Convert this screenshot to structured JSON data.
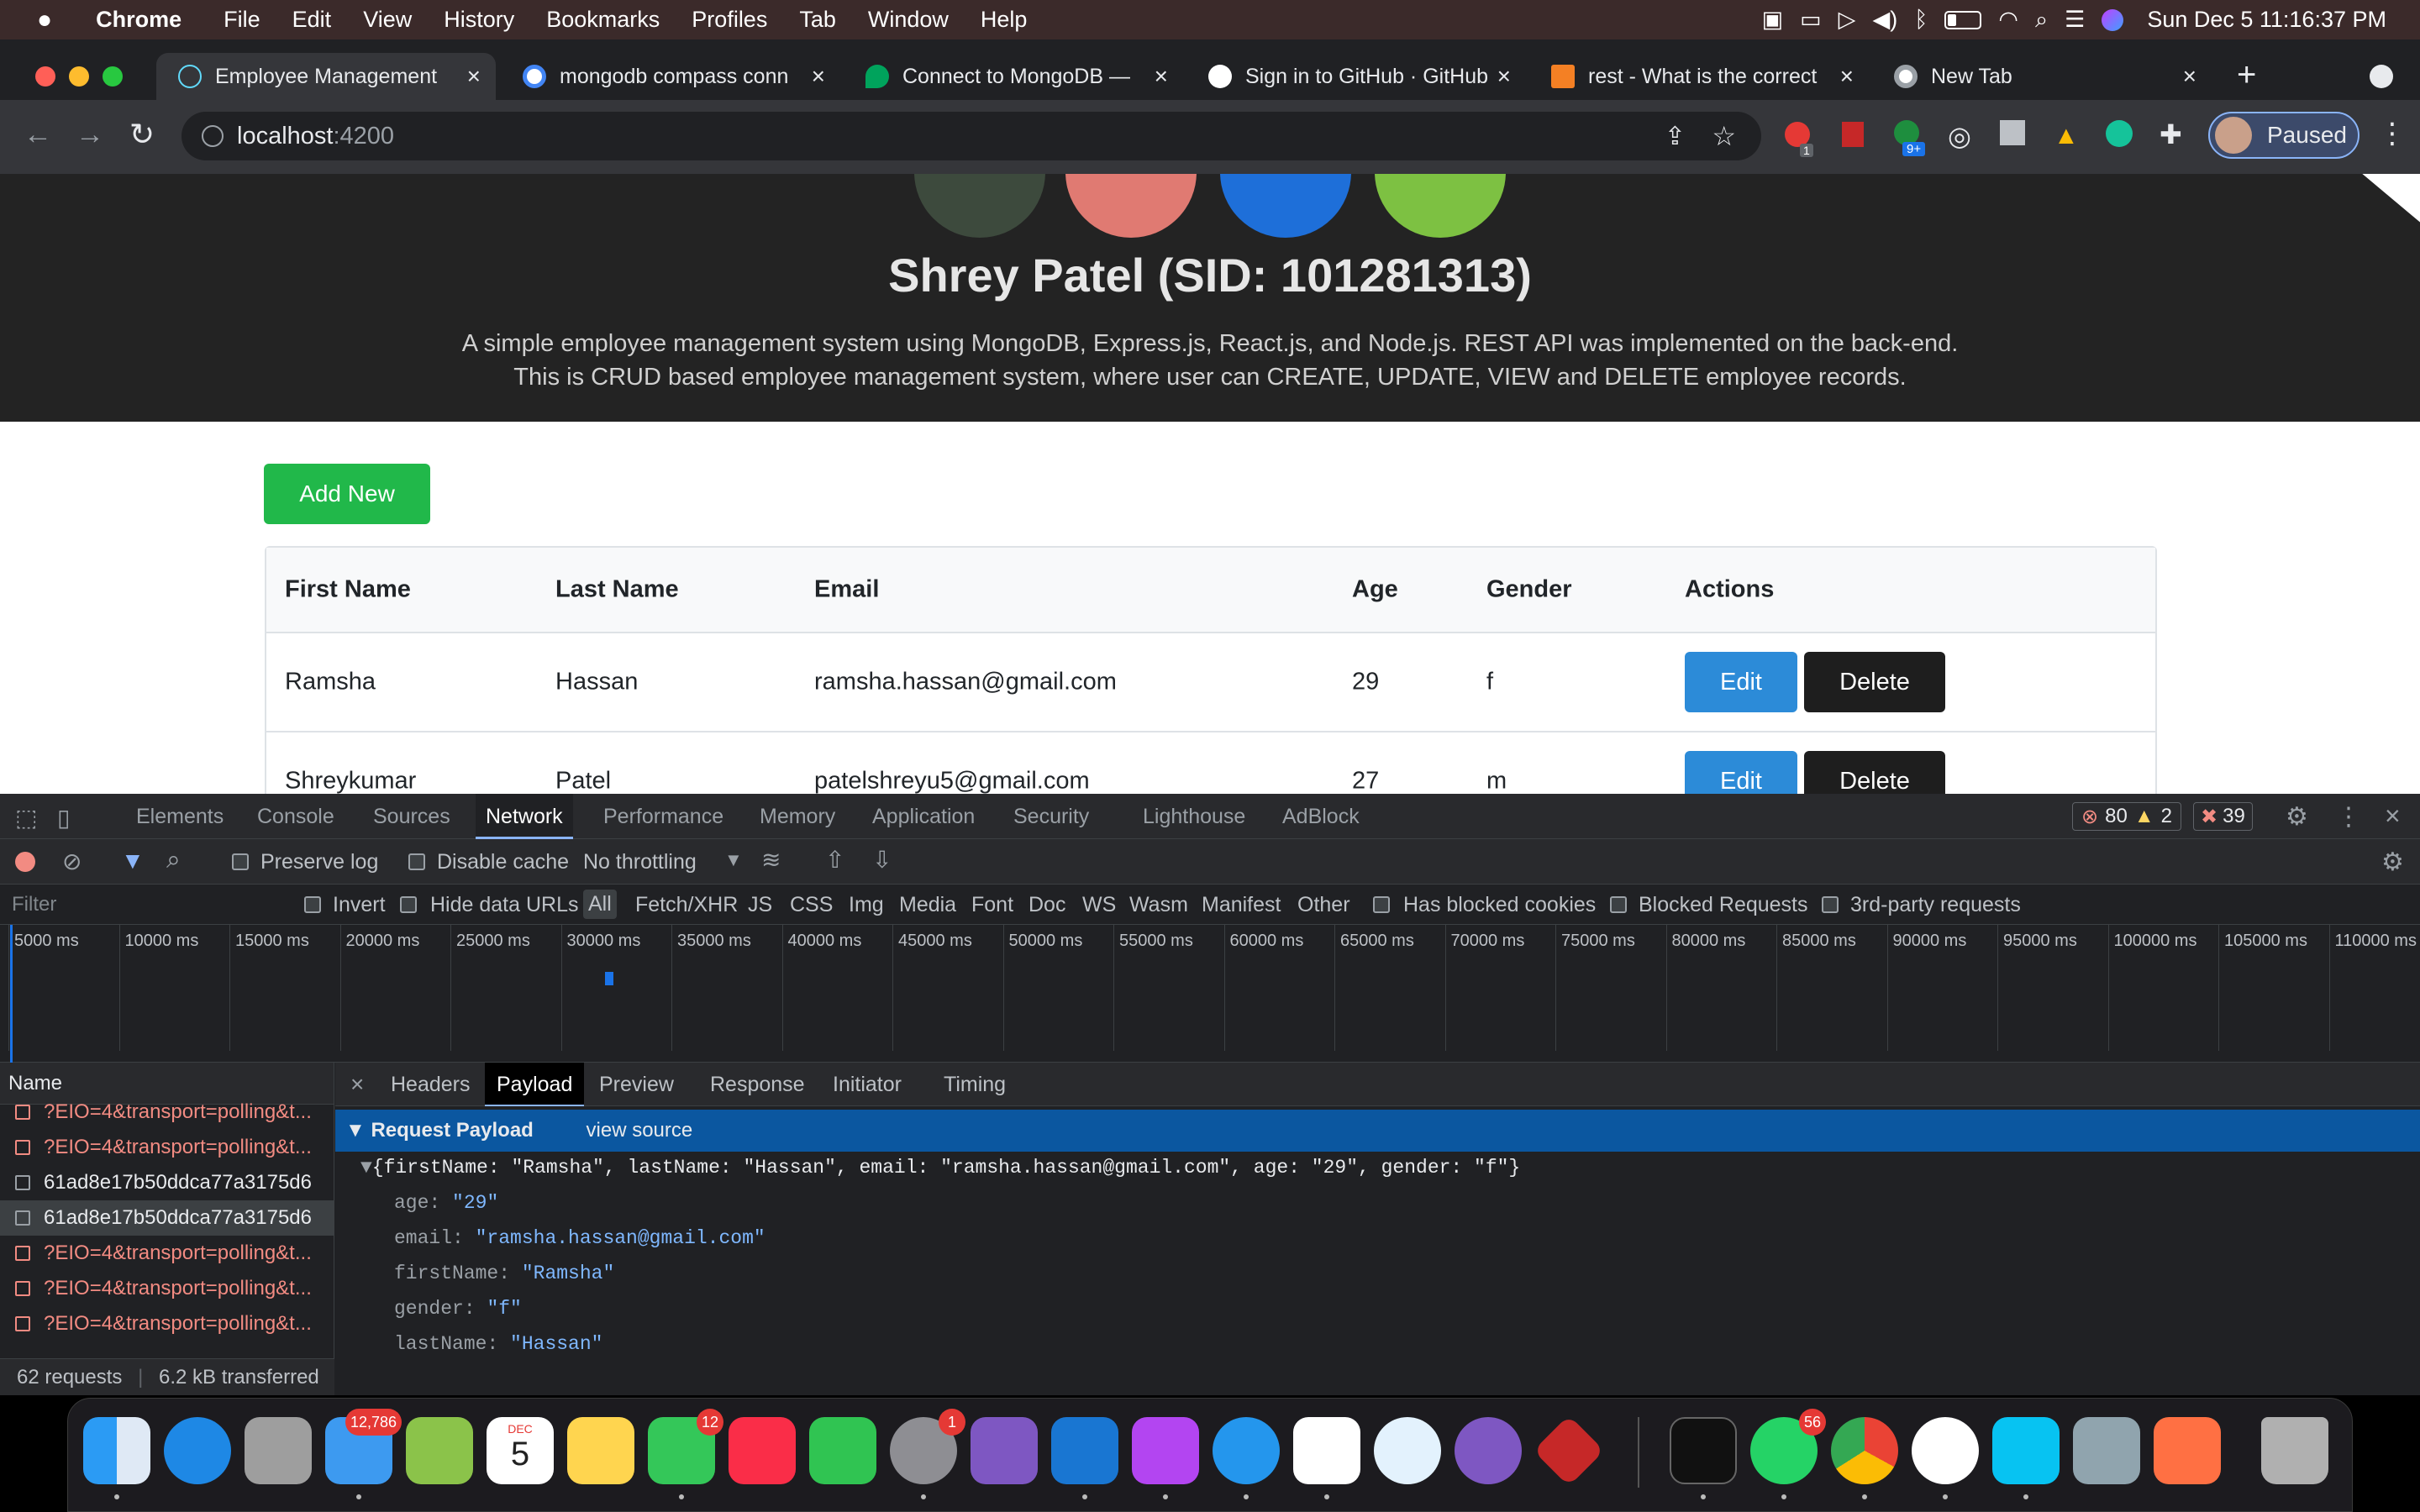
{
  "menubar": {
    "apple": "",
    "app": "Chrome",
    "items": [
      "File",
      "Edit",
      "View",
      "History",
      "Bookmarks",
      "Profiles",
      "Tab",
      "Window",
      "Help"
    ],
    "datetime": "Sun Dec 5  11:16:37 PM"
  },
  "tabs": [
    {
      "title": "Employee Management"
    },
    {
      "title": "mongodb compass conn"
    },
    {
      "title": "Connect to MongoDB —"
    },
    {
      "title": "Sign in to GitHub · GitHub"
    },
    {
      "title": "rest - What is the correct"
    },
    {
      "title": "New Tab"
    }
  ],
  "toolbar": {
    "url_host": "localhost",
    "url_port": ":4200",
    "profile": "Paused",
    "ext_badge1": "1",
    "ext_badge2": "9+"
  },
  "hero": {
    "title": "Shrey Patel (SID: 101281313)",
    "line1": "A simple employee management system using MongoDB, Express.js, React.js, and Node.js. REST API was implemented on the back-end.",
    "line2": "This is CRUD based employee management system, where user can CREATE, UPDATE, VIEW and DELETE employee records."
  },
  "add_new": "Add New",
  "table": {
    "headers": [
      "First Name",
      "Last Name",
      "Email",
      "Age",
      "Gender",
      "Actions"
    ],
    "rows": [
      {
        "first": "Ramsha",
        "last": "Hassan",
        "email": "ramsha.hassan@gmail.com",
        "age": "29",
        "gender": "f"
      },
      {
        "first": "Shreykumar",
        "last": "Patel",
        "email": "patelshreyu5@gmail.com",
        "age": "27",
        "gender": "m"
      }
    ],
    "edit": "Edit",
    "delete": "Delete"
  },
  "devtools": {
    "tabs": [
      "Elements",
      "Console",
      "Sources",
      "Network",
      "Performance",
      "Memory",
      "Application",
      "Security",
      "Lighthouse",
      "AdBlock"
    ],
    "errors": "80",
    "warnings": "2",
    "issues": "39",
    "preserve_log": "Preserve log",
    "disable_cache": "Disable cache",
    "throttling": "No throttling",
    "filter_placeholder": "Filter",
    "invert": "Invert",
    "hide_data_urls": "Hide data URLs",
    "types": [
      "All",
      "Fetch/XHR",
      "JS",
      "CSS",
      "Img",
      "Media",
      "Font",
      "Doc",
      "WS",
      "Wasm",
      "Manifest",
      "Other"
    ],
    "has_blocked": "Has blocked cookies",
    "blocked_requests": "Blocked Requests",
    "third_party": "3rd-party requests",
    "timeline": [
      "5000 ms",
      "10000 ms",
      "15000 ms",
      "20000 ms",
      "25000 ms",
      "30000 ms",
      "35000 ms",
      "40000 ms",
      "45000 ms",
      "50000 ms",
      "55000 ms",
      "60000 ms",
      "65000 ms",
      "70000 ms",
      "75000 ms",
      "80000 ms",
      "85000 ms",
      "90000 ms",
      "95000 ms",
      "100000 ms",
      "105000 ms",
      "110000 ms"
    ],
    "name_header": "Name",
    "requests": [
      {
        "name": "?EIO=4&transport=polling&t...",
        "err": true
      },
      {
        "name": "?EIO=4&transport=polling&t...",
        "err": true
      },
      {
        "name": "61ad8e17b50ddca77a3175d6",
        "err": false
      },
      {
        "name": "61ad8e17b50ddca77a3175d6",
        "err": false
      },
      {
        "name": "?EIO=4&transport=polling&t...",
        "err": true
      },
      {
        "name": "?EIO=4&transport=polling&t...",
        "err": true
      },
      {
        "name": "?EIO=4&transport=polling&t...",
        "err": true
      }
    ],
    "summary_requests": "62 requests",
    "summary_transferred": "6.2 kB transferred",
    "detail_tabs": [
      "Headers",
      "Payload",
      "Preview",
      "Response",
      "Initiator",
      "Timing"
    ],
    "payload_title": "Request Payload",
    "view_source": "view source",
    "payload_summary": "{firstName: \"Ramsha\", lastName: \"Hassan\", email: \"ramsha.hassan@gmail.com\", age: \"29\", gender: \"f\"}",
    "payload": [
      {
        "k": "age",
        "v": "\"29\""
      },
      {
        "k": "email",
        "v": "\"ramsha.hassan@gmail.com\""
      },
      {
        "k": "firstName",
        "v": "\"Ramsha\""
      },
      {
        "k": "gender",
        "v": "\"f\""
      },
      {
        "k": "lastName",
        "v": "\"Hassan\""
      }
    ]
  },
  "dock": {
    "mail_badge": "12,786",
    "messages_badge": "12",
    "settings_badge": "1",
    "whatsapp_badge": "56",
    "calendar_month": "DEC",
    "calendar_day": "5"
  }
}
